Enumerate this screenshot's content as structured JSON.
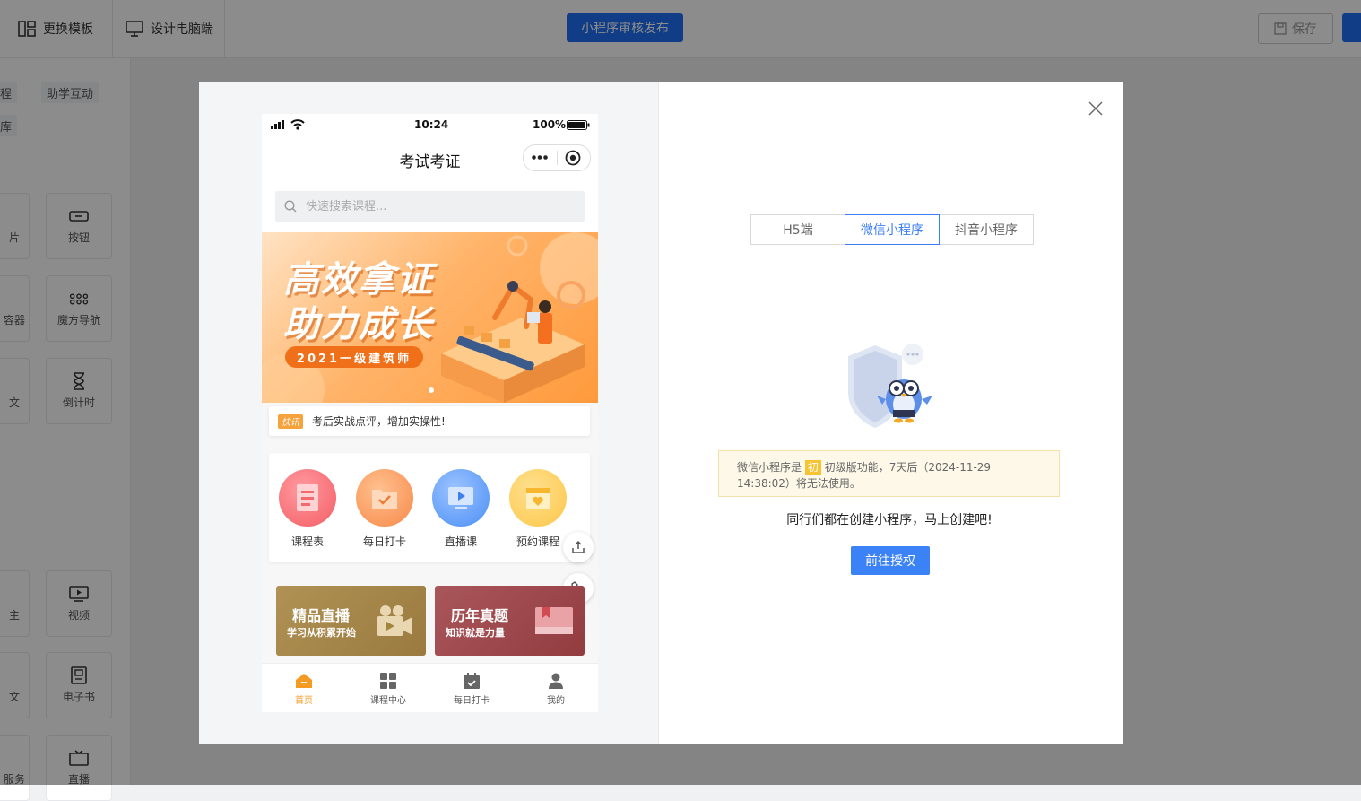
{
  "editor": {
    "change_template": "更换模板",
    "design_pc": "设计电脑端",
    "publish": "小程序审核发布",
    "save": "保存",
    "chip_top_left": "程",
    "chip_top_right": "助学互动",
    "chip_second": "库",
    "components": [
      {
        "label": "片",
        "label_right": "按钮"
      },
      {
        "label": "容器",
        "label_right": "魔方导航"
      },
      {
        "label": "文",
        "label_right": "倒计时"
      },
      {
        "label": "主",
        "label_right": "视频"
      },
      {
        "label": "文",
        "label_right": "电子书"
      },
      {
        "label": "服务",
        "label_right": "直播"
      }
    ]
  },
  "phone": {
    "status": {
      "time": "10:24",
      "battery": "100%"
    },
    "nav_title": "考试考证",
    "search_placeholder": "快速搜索课程...",
    "banner": {
      "line1": "高效拿证",
      "line2": "助力成长",
      "pill": "2021一级建筑师"
    },
    "notice": {
      "tag": "快讯",
      "text": "考后实战点评，增加实操性!"
    },
    "entries": [
      {
        "label": "课程表",
        "color": "#f45d64"
      },
      {
        "label": "每日打卡",
        "color": "#f7894a"
      },
      {
        "label": "直播课",
        "color": "#4b8ff6"
      },
      {
        "label": "预约课程",
        "color": "#fcc74a"
      }
    ],
    "promos": [
      {
        "title": "精品直播",
        "subtitle": "学习从积累开始",
        "color": "#a88748"
      },
      {
        "title": "历年真题",
        "subtitle": "知识就是力量",
        "color": "#a34a4c"
      }
    ],
    "tabs": [
      {
        "label": "首页",
        "active": true
      },
      {
        "label": "课程中心"
      },
      {
        "label": "每日打卡"
      },
      {
        "label": "我的"
      }
    ]
  },
  "platforms": [
    "H5端",
    "微信小程序",
    "抖音小程序"
  ],
  "selected_platform": "微信小程序",
  "notice_box": {
    "prefix": "微信小程序是",
    "tag": "初",
    "suffix": "初级版功能，7天后（2024-11-29 14:38:02）将无法使用。"
  },
  "cta_text": "同行们都在创建小程序，马上创建吧!",
  "authorize_button": "前往授权",
  "colors": {
    "accent": "#3b82f6",
    "tab_active": "#f59a23",
    "publish": "#1e6ff5"
  }
}
